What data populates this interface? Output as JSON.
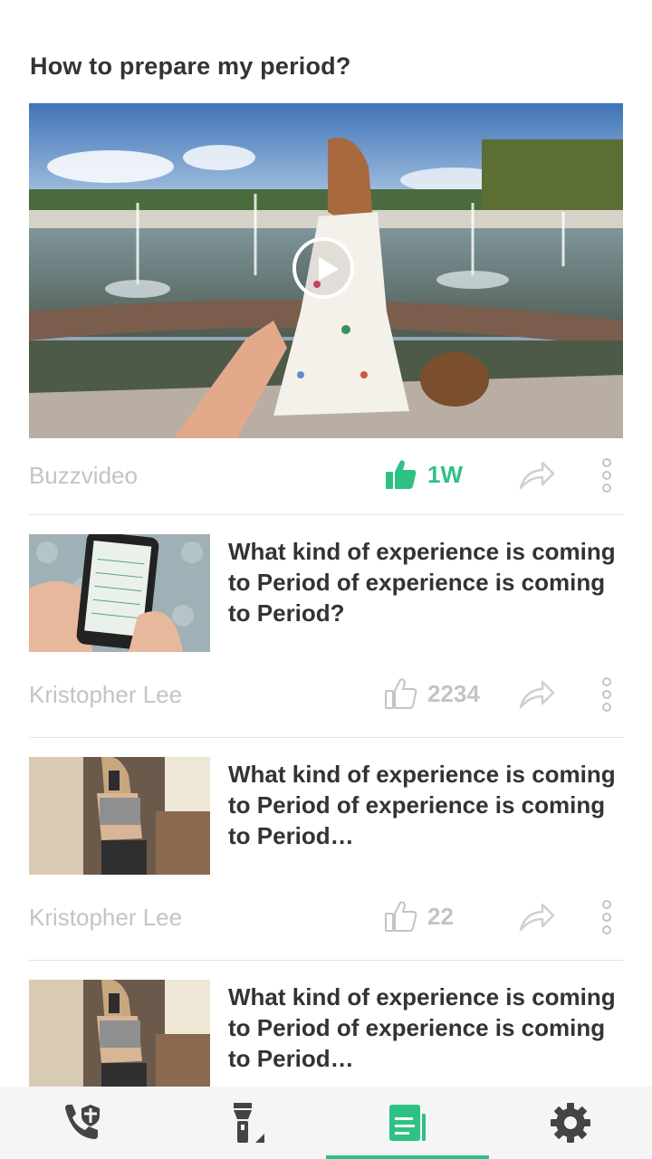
{
  "feed": {
    "title": "How to prepare my period?"
  },
  "featured": {
    "author": "Buzzvideo",
    "likes": "1W",
    "liked": true
  },
  "articles": [
    {
      "title": "What kind of experience is coming to Period of experience is coming to Period?",
      "author": "Kristopher Lee",
      "likes": "2234"
    },
    {
      "title": "What kind of experience is coming to Period of experience is coming to Period…",
      "author": "Kristopher Lee",
      "likes": "22"
    },
    {
      "title": "What kind of experience is coming to Period of experience is coming to Period…"
    }
  ],
  "tabs": [
    {
      "icon": "phone-shield-icon",
      "active": false
    },
    {
      "icon": "flashlight-icon",
      "active": false
    },
    {
      "icon": "news-icon",
      "active": true
    },
    {
      "icon": "gear-icon",
      "active": false
    }
  ],
  "colors": {
    "accent": "#2dc184",
    "text": "#333333",
    "muted": "#c4c4c4"
  }
}
